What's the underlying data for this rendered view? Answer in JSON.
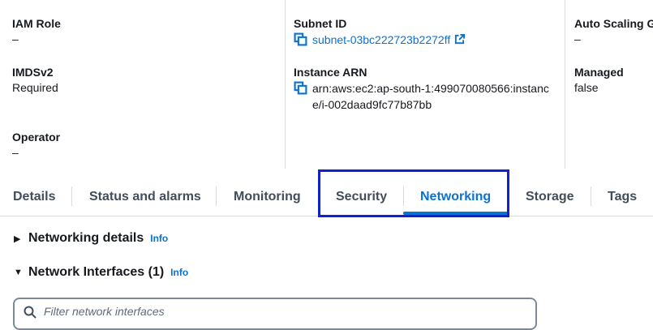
{
  "details": {
    "col1": [
      {
        "label": "IAM Role",
        "value": "–"
      },
      {
        "label": "IMDSv2",
        "value": "Required"
      },
      {
        "label": "Operator",
        "value": "–"
      }
    ],
    "subnet": {
      "label": "Subnet ID",
      "value": "subnet-03bc222723b2272ff"
    },
    "arn": {
      "label": "Instance ARN",
      "value": "arn:aws:ec2:ap-south-1:499070080566:instance/i-002daad9fc77b87bb"
    },
    "col3": [
      {
        "label": "Auto Scaling G",
        "value": "–"
      },
      {
        "label": "Managed",
        "value": "false"
      }
    ]
  },
  "tabs": {
    "details": "Details",
    "status": "Status and alarms",
    "monitoring": "Monitoring",
    "security": "Security",
    "networking": "Networking",
    "storage": "Storage",
    "tags": "Tags",
    "active": "Networking"
  },
  "sections": {
    "networking_details": {
      "title": "Networking details",
      "info": "Info",
      "expanded": false
    },
    "network_interfaces": {
      "title": "Network Interfaces (1)",
      "info": "Info",
      "expanded": true
    }
  },
  "search": {
    "placeholder": "Filter network interfaces"
  },
  "colors": {
    "link": "#0972d3",
    "highlight": "#1122cc",
    "divider": "#d5dbdb"
  }
}
